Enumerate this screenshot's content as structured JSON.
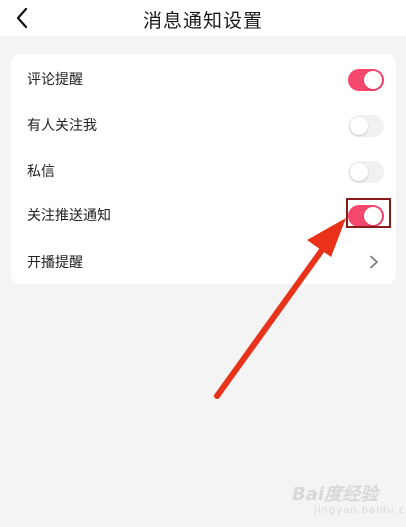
{
  "header": {
    "title": "消息通知设置",
    "back_icon": "chevron-left-icon"
  },
  "settings": [
    {
      "label": "评论提醒",
      "type": "toggle",
      "on": true
    },
    {
      "label": "有人关注我",
      "type": "toggle",
      "on": false
    },
    {
      "label": "私信",
      "type": "toggle",
      "on": false
    },
    {
      "label": "关注推送通知",
      "type": "toggle",
      "on": true
    },
    {
      "label": "开播提醒",
      "type": "link",
      "icon": "chevron-right-icon"
    }
  ],
  "colors": {
    "toggle_on": "#f5476d",
    "toggle_off": "#f1f1f1",
    "annotation": "#e8331a",
    "highlight_border": "#8b1a1a"
  },
  "watermark": {
    "brand": "Bai度经验",
    "sub": "jingyan.baidu.com"
  }
}
